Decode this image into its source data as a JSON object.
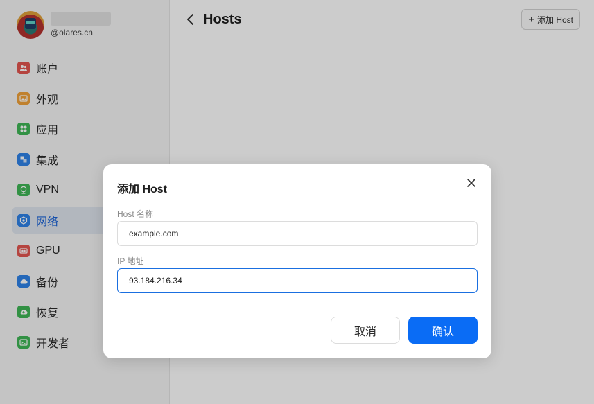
{
  "profile": {
    "domain": "@olares.cn",
    "avatar_icon": "avatar-icon"
  },
  "sidebar": {
    "items": [
      {
        "label": "账户",
        "icon": "user-icon",
        "color": "#e3554f",
        "active": false
      },
      {
        "label": "外观",
        "icon": "image-icon",
        "color": "#f0a23a",
        "active": false
      },
      {
        "label": "应用",
        "icon": "apps-grid-icon",
        "color": "#3fb655",
        "active": false
      },
      {
        "label": "集成",
        "icon": "integration-icon",
        "color": "#2f82e8",
        "active": false
      },
      {
        "label": "VPN",
        "icon": "vpn-globe-icon",
        "color": "#3fb655",
        "active": false
      },
      {
        "label": "网络",
        "icon": "network-icon",
        "color": "#2f82e8",
        "active": true
      },
      {
        "label": "GPU",
        "icon": "gpu-icon",
        "color": "#e3554f",
        "active": false
      },
      {
        "label": "备份",
        "icon": "cloud-icon",
        "color": "#2f82e8",
        "active": false
      },
      {
        "label": "恢复",
        "icon": "restore-cloud-icon",
        "color": "#3fb655",
        "active": false
      },
      {
        "label": "开发者",
        "icon": "terminal-icon",
        "color": "#3fb655",
        "active": false
      }
    ]
  },
  "header": {
    "title": "Hosts",
    "add_button_label": "添加 Host",
    "add_button_icon": "plus-icon",
    "back_icon": "chevron-left-icon"
  },
  "dialog": {
    "title": "添加 Host",
    "close_icon": "close-icon",
    "host_name_label": "Host 名称",
    "host_name_value": "example.com",
    "ip_label": "IP 地址",
    "ip_value": "93.184.216.34",
    "cancel_label": "取消",
    "confirm_label": "确认"
  },
  "colors": {
    "accent": "#0a6cf5",
    "active_nav_bg": "#dfe5ee",
    "active_nav_text": "#1a63d8"
  }
}
